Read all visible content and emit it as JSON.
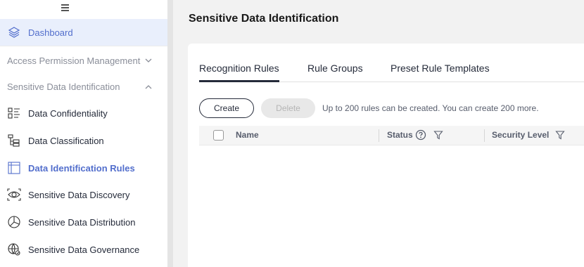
{
  "sidebar": {
    "menu_icon": "menu-icon",
    "dashboard": {
      "label": "Dashboard",
      "icon": "layers-icon"
    },
    "groups": [
      {
        "label": "Access Permission Management",
        "expanded": false
      },
      {
        "label": "Sensitive Data Identification",
        "expanded": true
      }
    ],
    "items": [
      {
        "label": "Data Confidentiality",
        "icon": "confidentiality-icon",
        "active": false
      },
      {
        "label": "Data Classification",
        "icon": "classification-icon",
        "active": false
      },
      {
        "label": "Data Identification Rules",
        "icon": "rules-icon",
        "active": true
      },
      {
        "label": "Sensitive Data Discovery",
        "icon": "eye-icon",
        "active": false
      },
      {
        "label": "Sensitive Data Distribution",
        "icon": "pie-chart-icon",
        "active": false
      },
      {
        "label": "Sensitive Data Governance",
        "icon": "governance-icon",
        "active": false
      }
    ]
  },
  "main": {
    "title": "Sensitive Data Identification",
    "tabs": [
      {
        "label": "Recognition Rules",
        "active": true
      },
      {
        "label": "Rule Groups",
        "active": false
      },
      {
        "label": "Preset Rule Templates",
        "active": false
      }
    ],
    "toolbar": {
      "create_label": "Create",
      "delete_label": "Delete",
      "delete_disabled": true,
      "hint": "Up to 200 rules can be created. You can create 200 more."
    },
    "table": {
      "columns": [
        {
          "label": "Name"
        },
        {
          "label": "Status",
          "help_icon": true,
          "filter_icon": true
        },
        {
          "label": "Security Level",
          "filter_icon": true
        }
      ]
    }
  },
  "colors": {
    "accent": "#526ecc",
    "active_bg": "#e9effc",
    "page_bg": "#f2f2f2"
  }
}
